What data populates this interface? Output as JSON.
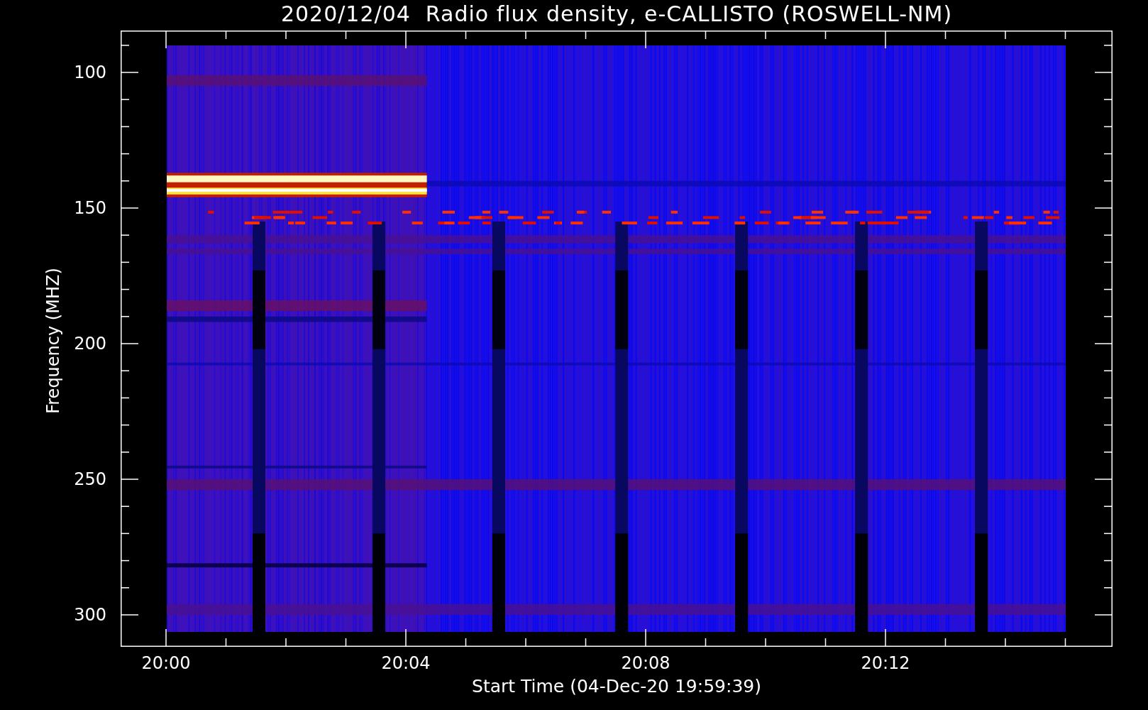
{
  "title": "2020/12/04  Radio flux density, e-CALLISTO (ROSWELL-NM)",
  "y_axis": {
    "label": "Frequency (MHZ)",
    "ticks": [
      "100",
      "150",
      "200",
      "250",
      "300"
    ]
  },
  "x_axis": {
    "label": "Start Time (04-Dec-20 19:59:39)",
    "ticks": [
      "20:00",
      "20:04",
      "20:08",
      "20:12"
    ]
  }
}
